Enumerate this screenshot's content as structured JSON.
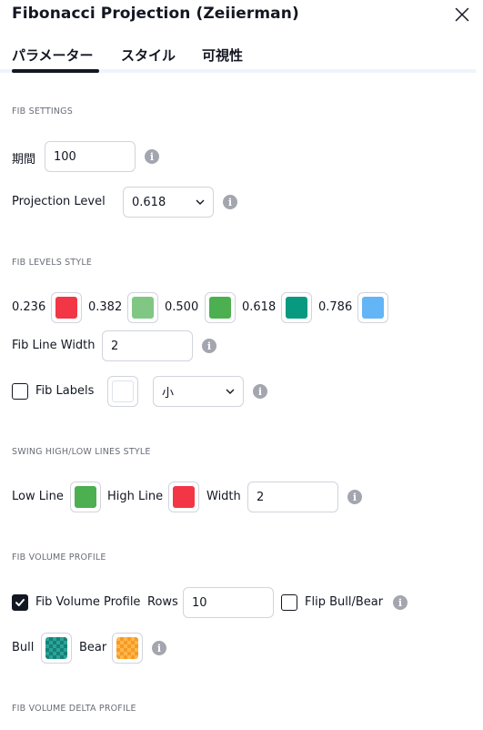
{
  "dialog": {
    "title": "Fibonacci Projection (Zeiierman)"
  },
  "tabs": [
    {
      "label": "パラメーター",
      "active": true
    },
    {
      "label": "スタイル",
      "active": false
    },
    {
      "label": "可視性",
      "active": false
    }
  ],
  "fib_settings": {
    "section_label": "FIB SETTINGS",
    "period_label": "期間",
    "period_value": "100",
    "projection_label": "Projection Level",
    "projection_value": "0.618"
  },
  "fib_levels_style": {
    "section_label": "FIB LEVELS STYLE",
    "levels": [
      {
        "label": "0.236",
        "color": "#f23645"
      },
      {
        "label": "0.382",
        "color": "#81c784"
      },
      {
        "label": "0.500",
        "color": "#4caf50"
      },
      {
        "label": "0.618",
        "color": "#089981"
      },
      {
        "label": "0.786",
        "color": "#64b5f6"
      }
    ],
    "line_width_label": "Fib Line Width",
    "line_width_value": "2",
    "labels_label": "Fib Labels",
    "labels_checked": false,
    "labels_color": "#ffffff",
    "labels_size": "小"
  },
  "swing_lines_style": {
    "section_label": "SWING HIGH/LOW LINES STYLE",
    "low_line_label": "Low Line",
    "low_line_color": "#4caf50",
    "high_line_label": "High Line",
    "high_line_color": "#f23645",
    "width_label": "Width",
    "width_value": "2"
  },
  "fib_volume_profile": {
    "section_label": "FIB VOLUME PROFILE",
    "enabled_label": "Fib Volume Profile",
    "enabled_checked": true,
    "rows_label": "Rows",
    "rows_value": "10",
    "flip_label": "Flip Bull/Bear",
    "flip_checked": false,
    "bull_label": "Bull",
    "bull_color": "#26a69a",
    "bear_label": "Bear",
    "bear_color": "#ffb74d"
  },
  "fib_volume_delta_profile": {
    "section_label": "FIB VOLUME DELTA PROFILE"
  }
}
